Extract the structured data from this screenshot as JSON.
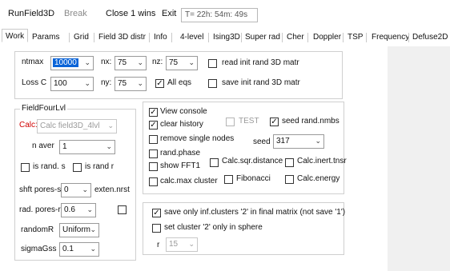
{
  "toolbar": {
    "run": "RunField3D",
    "break": "Break",
    "close": "Close 1 wins",
    "exit": "Exit",
    "timer": "T= 22h: 54m: 49s"
  },
  "tabs": [
    "Work",
    "Params",
    "Grid",
    "Field 3D distr",
    "Info",
    "4-level",
    "Ising3D",
    "Super rad",
    "Cher",
    "Doppler",
    "TSP",
    "Frequency",
    "Defuse2D"
  ],
  "top": {
    "ntmax_label": "ntmax",
    "ntmax_value": "10000",
    "lossc_label": "Loss C",
    "lossc_value": "100",
    "nx_label": "nx:",
    "nx_value": "75",
    "nz_label": "nz:",
    "nz_value": "75",
    "ny_label": "ny:",
    "ny_value": "75",
    "alleqs_label": "All eqs",
    "read_label": "read init rand 3D matr",
    "save_label": "save init rand 3D matr"
  },
  "field": {
    "legend": "FieldFourLvl",
    "calc_label": "Calc:",
    "calc_value": "Calc field3D_4lvl",
    "naver_label": "n aver",
    "naver_value": "1",
    "israndS": "is rand. s",
    "israndR": "is rand r",
    "shft_label": "shft pores-s",
    "shft_value": "0",
    "exten_label": "exten.nrst",
    "radpores_label": "rad. pores-r",
    "radpores_value": "0.6",
    "randomR_label": "randomR",
    "randomR_value": "Uniform",
    "sigma_label": "sigmaGss",
    "sigma_value": "0.1"
  },
  "options": {
    "view_console": "View console",
    "clear_history": "clear history",
    "test": "TEST",
    "seed_rand": "seed rand.nmbs",
    "remove_single": "remove single nodes",
    "seed_label": "seed",
    "seed_value": "317",
    "rand_phase": "rand.phase",
    "show_fft": "show FFT1",
    "calc_sqr": "Calc.sqr.distance",
    "calc_inert": "Calc.inert.tnsr",
    "calc_max": "calc.max cluster",
    "fibonacci": "Fibonacci",
    "calc_energy": "Calc.energy"
  },
  "bottom": {
    "save_only": "save only inf.clusters '2' in final matrix (not save '1')",
    "set_cluster": "set cluster '2' only in sphere",
    "r_label": "r",
    "r_value": "15"
  },
  "checked": {
    "alleqs": true,
    "read": false,
    "save": false,
    "israndS": false,
    "israndR": false,
    "exten": false,
    "view_console": true,
    "clear_history": true,
    "test": false,
    "seed_rand": true,
    "remove_single": false,
    "rand_phase": false,
    "show_fft": false,
    "calc_sqr": false,
    "calc_inert": false,
    "calc_max": false,
    "fibonacci": false,
    "calc_energy": false,
    "save_only": true,
    "set_cluster": false
  },
  "colors": {
    "selection": "#0a64d8",
    "calc_label": "#d00000"
  }
}
